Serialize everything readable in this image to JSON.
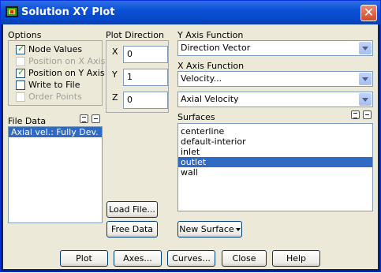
{
  "window": {
    "title": "Solution XY Plot",
    "close_glyph": "✕"
  },
  "options": {
    "label": "Options",
    "items": [
      {
        "label": "Node Values",
        "checked": true,
        "enabled": true
      },
      {
        "label": "Position on X Axis",
        "checked": false,
        "enabled": false
      },
      {
        "label": "Position on Y Axis",
        "checked": true,
        "enabled": true
      },
      {
        "label": "Write to File",
        "checked": false,
        "enabled": true
      },
      {
        "label": "Order Points",
        "checked": false,
        "enabled": false
      }
    ]
  },
  "plot_direction": {
    "label": "Plot Direction",
    "x_label": "X",
    "x_value": "0",
    "y_label": "Y",
    "y_value": "1",
    "z_label": "Z",
    "z_value": "0"
  },
  "y_axis_function": {
    "label": "Y Axis Function",
    "value": "Direction Vector"
  },
  "x_axis_function": {
    "label": "X Axis Function",
    "value": "Velocity...",
    "sub_value": "Axial Velocity"
  },
  "file_data": {
    "label": "File Data",
    "items": [
      "Axial vel.: Fully Dev."
    ],
    "selected_index": 0
  },
  "surfaces": {
    "label": "Surfaces",
    "items": [
      "centerline",
      "default-interior",
      "inlet",
      "outlet",
      "wall"
    ],
    "selected_index": 3
  },
  "buttons": {
    "load_file": "Load File...",
    "free_data": "Free Data",
    "new_surface": "New Surface",
    "plot": "Plot",
    "axes": "Axes...",
    "curves": "Curves...",
    "close": "Close",
    "help": "Help"
  },
  "colors": {
    "title_bar": "#0a51d6",
    "selection": "#316ac5",
    "dialog_bg": "#ece9d8",
    "check": "#21a121"
  }
}
